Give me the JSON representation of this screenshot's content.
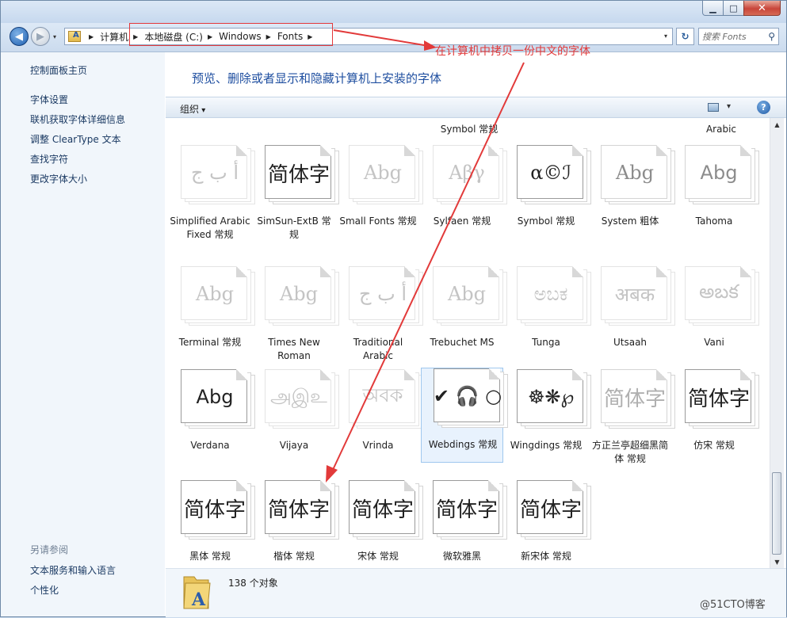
{
  "window": {
    "minimize": "▁",
    "maximize": "□",
    "close": "✕"
  },
  "nav": {
    "back_glyph": "◀",
    "forward_glyph": "▶",
    "dropdown_glyph": "▾",
    "breadcrumbs": [
      "计算机",
      "本地磁盘 (C:)",
      "Windows",
      "Fonts"
    ],
    "crumb_sep": "▶",
    "refresh_glyph": "↻",
    "search_placeholder": "搜索 Fonts",
    "search_glyph": "⚲"
  },
  "annotation": {
    "note": "在计算机中拷贝一份中文的字体",
    "color": "#e23a3a"
  },
  "sidebar": {
    "top_items": [
      "控制面板主页",
      "字体设置",
      "联机获取字体详细信息",
      "调整 ClearType 文本",
      "查找字符",
      "更改字体大小"
    ],
    "see_also_title": "另请参阅",
    "see_also_items": [
      "文本服务和输入语言",
      "个性化"
    ]
  },
  "header": {
    "title": "预览、删除或者显示和隐藏计算机上安装的字体"
  },
  "commandbar": {
    "organize": "组织",
    "view_dropdown": "▾",
    "help": "?"
  },
  "partial_labels": [
    "Symbol 常规",
    "Arabic"
  ],
  "rows": [
    [
      {
        "label": "Simplified Arabic Fixed 常规",
        "sample": "أ ب ج",
        "style": "faded"
      },
      {
        "label": "SimSun-ExtB 常规",
        "sample": "简体字",
        "style": "dark"
      },
      {
        "label": "Small Fonts 常规",
        "sample": "Abg",
        "style": "faded"
      },
      {
        "label": "Sylfaen 常规",
        "sample": "Αβγ",
        "style": "faded"
      },
      {
        "label": "Symbol 常规",
        "sample": "α©ℐ",
        "style": "dark"
      },
      {
        "label": "System 粗体",
        "sample": "Abg",
        "style": "gray"
      },
      {
        "label": "Tahoma",
        "sample": "Abg",
        "style": "gray"
      }
    ],
    [
      {
        "label": "Terminal 常规",
        "sample": "Abg",
        "style": "faded"
      },
      {
        "label": "Times New Roman",
        "sample": "Abg",
        "style": "faded"
      },
      {
        "label": "Traditional Arabic",
        "sample": "أ ب ج",
        "style": "faded"
      },
      {
        "label": "Trebuchet MS",
        "sample": "Abg",
        "style": "faded"
      },
      {
        "label": "Tunga",
        "sample": "ಅಬಕ",
        "style": "faded"
      },
      {
        "label": "Utsaah",
        "sample": "अबक",
        "style": "faded"
      },
      {
        "label": "Vani",
        "sample": "అబక",
        "style": "faded"
      }
    ],
    [
      {
        "label": "Verdana",
        "sample": "Abg",
        "style": "dark"
      },
      {
        "label": "Vijaya",
        "sample": "அஇஉ",
        "style": "faded"
      },
      {
        "label": "Vrinda",
        "sample": "অবক",
        "style": "faded"
      },
      {
        "label": "Webdings 常规",
        "sample": "✔ 🎧 ○",
        "style": "dark",
        "selected": true
      },
      {
        "label": "Wingdings 常规",
        "sample": "☸❋℘",
        "style": "dark"
      },
      {
        "label": "方正兰亭超细黑简体 常规",
        "sample": "简体字",
        "style": "gray"
      },
      {
        "label": "仿宋 常规",
        "sample": "简体字",
        "style": "dark"
      }
    ],
    [
      {
        "label": "黑体 常规",
        "sample": "简体字",
        "style": "dark"
      },
      {
        "label": "楷体 常规",
        "sample": "简体字",
        "style": "dark"
      },
      {
        "label": "宋体 常规",
        "sample": "简体字",
        "style": "dark"
      },
      {
        "label": "微软雅黑",
        "sample": "简体字",
        "style": "dark"
      },
      {
        "label": "新宋体 常规",
        "sample": "简体字",
        "style": "dark"
      }
    ]
  ],
  "status": {
    "count": "138 个对象"
  },
  "watermark": "@51CTO博客"
}
